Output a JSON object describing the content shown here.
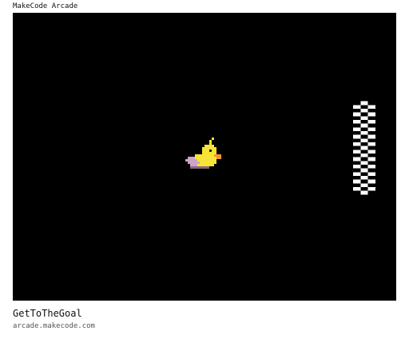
{
  "window": {
    "title": "MakeCode Arcade"
  },
  "game": {
    "sprites": [
      {
        "name": "duck",
        "icon": "duck-sprite-icon"
      },
      {
        "name": "goal",
        "icon": "checkered-flag-icon"
      }
    ],
    "colors": {
      "background": "#000000",
      "duck_body": "#f7e436",
      "duck_beak": "#f29236",
      "duck_wing": "#c9a6c8",
      "goal_light": "#ffffff",
      "goal_dark": "#000000"
    }
  },
  "footer": {
    "game_name": "GetToTheGoal",
    "site": "arcade.makecode.com"
  }
}
